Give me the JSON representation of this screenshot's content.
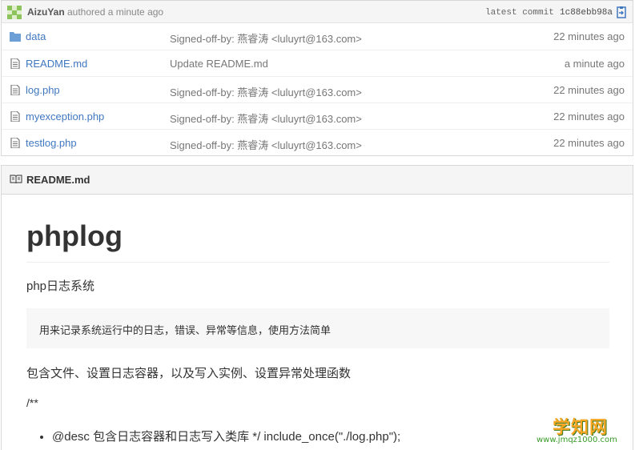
{
  "commit": {
    "author": "AizuYan",
    "authored_text": "authored a minute ago",
    "latest_label": "latest commit",
    "sha": "1c88ebb98a"
  },
  "files": [
    {
      "name": "data",
      "type": "folder",
      "message": "Signed-off-by: 燕睿涛 <luluyrt@163.com>",
      "age": "22 minutes ago"
    },
    {
      "name": "README.md",
      "type": "file",
      "message": "Update README.md",
      "age": "a minute ago"
    },
    {
      "name": "log.php",
      "type": "file",
      "message": "Signed-off-by: 燕睿涛 <luluyrt@163.com>",
      "age": "22 minutes ago"
    },
    {
      "name": "myexception.php",
      "type": "file",
      "message": "Signed-off-by: 燕睿涛 <luluyrt@163.com>",
      "age": "22 minutes ago"
    },
    {
      "name": "testlog.php",
      "type": "file",
      "message": "Signed-off-by: 燕睿涛 <luluyrt@163.com>",
      "age": "22 minutes ago"
    }
  ],
  "readme": {
    "header": "README.md",
    "title": "phplog",
    "subtitle": "php日志系统",
    "quote": "用来记录系统运行中的日志，错误、异常等信息，使用方法简单",
    "includes": "包含文件、设置日志容器，以及写入实例、设置异常处理函数",
    "comment": "/**",
    "list": [
      "@desc 包含日志容器和日志写入类库 */ include_once(\"./log.php\");"
    ]
  },
  "watermark": {
    "title": "学知网",
    "url": "www.jmqz1000.com"
  },
  "colors": {
    "link": "#4078c0",
    "folder": "#6c9fd6",
    "muted": "#777777"
  }
}
